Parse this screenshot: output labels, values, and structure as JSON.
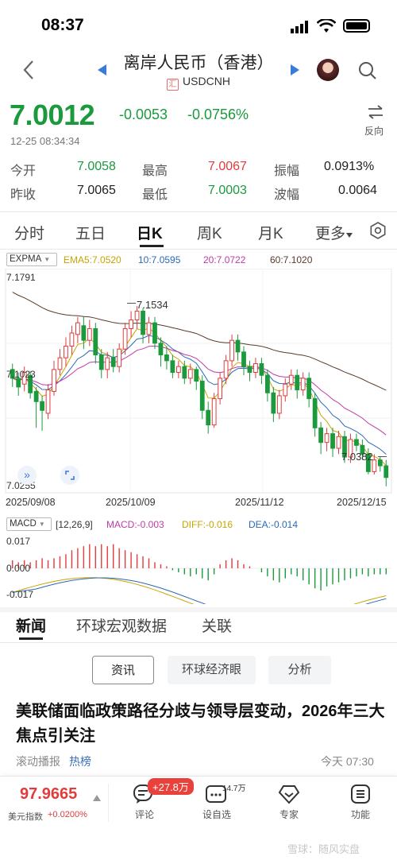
{
  "status_bar": {
    "time": "08:37"
  },
  "header": {
    "title": "离岸人民币（香港）",
    "symbol_icon": "汇",
    "symbol": "USDCNH"
  },
  "quote": {
    "price": "7.0012",
    "change": "-0.0053",
    "change_pct": "-0.0756%",
    "timestamp": "12-25 08:34:34",
    "flip_label": "反向",
    "stats": [
      {
        "label": "今开",
        "value": "7.0058",
        "color": "#1a9a3c"
      },
      {
        "label": "最高",
        "value": "7.0067",
        "color": "#e23b3b"
      },
      {
        "label": "振幅",
        "value": "0.0913%",
        "color": "#222222"
      },
      {
        "label": "昨收",
        "value": "7.0065",
        "color": "#222222"
      },
      {
        "label": "最低",
        "value": "7.0003",
        "color": "#1a9a3c"
      },
      {
        "label": "波幅",
        "value": "0.0064",
        "color": "#222222"
      }
    ]
  },
  "chart_tabs": [
    "分时",
    "五日",
    "日K",
    "周K",
    "月K",
    "更多"
  ],
  "active_chart_tab": "日K",
  "ema_legend": {
    "selector": "EXPMA",
    "ema5": "EMA5:7.0520",
    "ema10": "10:7.0595",
    "ema20": "20:7.0722",
    "ema60": "60:7.1020"
  },
  "price_axis": {
    "top": "7.1791",
    "mid": "7.1023",
    "bottom": "7.0255",
    "hi_mark": "7.1534",
    "lo_mark": "7.0382"
  },
  "dates": [
    "2025/09/08",
    "2025/10/09",
    "2025/11/12",
    "2025/12/15"
  ],
  "macd_legend": {
    "selector": "MACD",
    "params": "[12,26,9]",
    "macd": "MACD:-0.003",
    "diff": "DIFF:-0.016",
    "dea": "DEA:-0.014"
  },
  "macd_axis": {
    "top": "0.017",
    "mid": "0.000",
    "bottom": "-0.017"
  },
  "news_tabs": [
    "新闻",
    "环球宏观数据",
    "关联"
  ],
  "active_news_tab": "新闻",
  "filters": [
    "资讯",
    "环球经济眼",
    "分析"
  ],
  "article": {
    "headline": "美联储面临政策路径分歧与领导层变动，2026年三大焦点引关注",
    "source": "滚动播报",
    "tag": "热榜",
    "time": "今天 07:30"
  },
  "bottom_bar": {
    "index_value": "97.9665",
    "index_name": "美元指数",
    "index_change": "+0.0200%",
    "comment_label": "评论",
    "comment_badge": "+27.8万",
    "watch_label": "设自选",
    "watch_badge": "14.7万",
    "expert_label": "专家",
    "func_label": "功能"
  },
  "watermark": "雪球：随风实盘",
  "chart_data": {
    "type": "candlestick",
    "x_labels": [
      "2025/09/08",
      "2025/10/09",
      "2025/11/12",
      "2025/12/15"
    ],
    "ylim": [
      7.0255,
      7.1791
    ],
    "candles": [
      [
        7.11,
        7.104,
        7.114,
        7.098
      ],
      [
        7.104,
        7.098,
        7.108,
        7.092
      ],
      [
        7.1,
        7.108,
        7.112,
        7.095
      ],
      [
        7.106,
        7.094,
        7.109,
        7.09
      ],
      [
        7.095,
        7.088,
        7.098,
        7.07
      ],
      [
        7.088,
        7.082,
        7.092,
        7.068
      ],
      [
        7.08,
        7.096,
        7.1,
        7.076
      ],
      [
        7.095,
        7.11,
        7.116,
        7.092
      ],
      [
        7.11,
        7.118,
        7.124,
        7.106
      ],
      [
        7.118,
        7.126,
        7.132,
        7.112
      ],
      [
        7.126,
        7.135,
        7.14,
        7.12
      ],
      [
        7.134,
        7.142,
        7.146,
        7.128
      ],
      [
        7.14,
        7.13,
        7.146,
        7.124
      ],
      [
        7.13,
        7.138,
        7.144,
        7.126
      ],
      [
        7.138,
        7.12,
        7.142,
        7.114
      ],
      [
        7.12,
        7.11,
        7.124,
        7.104
      ],
      [
        7.11,
        7.118,
        7.122,
        7.104
      ],
      [
        7.118,
        7.112,
        7.124,
        7.108
      ],
      [
        7.112,
        7.124,
        7.128,
        7.108
      ],
      [
        7.124,
        7.138,
        7.142,
        7.12
      ],
      [
        7.138,
        7.144,
        7.15,
        7.132
      ],
      [
        7.144,
        7.15,
        7.1534,
        7.138
      ],
      [
        7.15,
        7.134,
        7.152,
        7.128
      ],
      [
        7.134,
        7.142,
        7.146,
        7.128
      ],
      [
        7.142,
        7.128,
        7.146,
        7.124
      ],
      [
        7.128,
        7.12,
        7.132,
        7.112
      ],
      [
        7.12,
        7.116,
        7.126,
        7.11
      ],
      [
        7.116,
        7.108,
        7.12,
        7.104
      ],
      [
        7.108,
        7.112,
        7.116,
        7.104
      ],
      [
        7.112,
        7.104,
        7.116,
        7.1
      ],
      [
        7.104,
        7.11,
        7.114,
        7.1
      ],
      [
        7.11,
        7.102,
        7.112,
        7.096
      ],
      [
        7.102,
        7.082,
        7.106,
        7.076
      ],
      [
        7.082,
        7.072,
        7.088,
        7.066
      ],
      [
        7.072,
        7.09,
        7.094,
        7.07
      ],
      [
        7.09,
        7.104,
        7.108,
        7.086
      ],
      [
        7.104,
        7.116,
        7.12,
        7.1
      ],
      [
        7.116,
        7.13,
        7.134,
        7.112
      ],
      [
        7.13,
        7.122,
        7.134,
        7.116
      ],
      [
        7.122,
        7.112,
        7.126,
        7.106
      ],
      [
        7.112,
        7.108,
        7.116,
        7.102
      ],
      [
        7.108,
        7.114,
        7.118,
        7.104
      ],
      [
        7.114,
        7.106,
        7.118,
        7.1
      ],
      [
        7.106,
        7.094,
        7.11,
        7.088
      ],
      [
        7.094,
        7.08,
        7.098,
        7.074
      ],
      [
        7.08,
        7.092,
        7.096,
        7.076
      ],
      [
        7.092,
        7.1,
        7.104,
        7.088
      ],
      [
        7.1,
        7.106,
        7.11,
        7.096
      ],
      [
        7.106,
        7.096,
        7.11,
        7.09
      ],
      [
        7.096,
        7.104,
        7.108,
        7.092
      ],
      [
        7.104,
        7.09,
        7.108,
        7.084
      ],
      [
        7.09,
        7.07,
        7.094,
        7.064
      ],
      [
        7.07,
        7.06,
        7.074,
        7.052
      ],
      [
        7.06,
        7.066,
        7.07,
        7.054
      ],
      [
        7.066,
        7.056,
        7.07,
        7.05
      ],
      [
        7.056,
        7.064,
        7.068,
        7.052
      ],
      [
        7.064,
        7.05,
        7.068,
        7.046
      ],
      [
        7.05,
        7.062,
        7.066,
        7.046
      ],
      [
        7.062,
        7.058,
        7.066,
        7.054
      ],
      [
        7.058,
        7.052,
        7.062,
        7.048
      ],
      [
        7.052,
        7.04,
        7.056,
        7.0382
      ],
      [
        7.04,
        7.048,
        7.052,
        7.038
      ],
      [
        7.048,
        7.044,
        7.05,
        7.04
      ],
      [
        7.044,
        7.036,
        7.048,
        7.03
      ]
    ],
    "macd_bars": [
      0.004,
      0.003,
      0.004,
      0.003,
      0.004,
      0.005,
      0.004,
      0.005,
      0.006,
      0.007,
      0.009,
      0.01,
      0.011,
      0.012,
      0.011,
      0.012,
      0.011,
      0.012,
      0.01,
      0.009,
      0.008,
      0.007,
      0.006,
      0.005,
      0.003,
      0.002,
      0.001,
      -0.001,
      -0.002,
      -0.003,
      -0.004,
      -0.003,
      -0.005,
      -0.006,
      -0.003,
      0.002,
      0.004,
      0.005,
      0.004,
      0.002,
      0.001,
      0.0,
      -0.002,
      -0.004,
      -0.006,
      -0.007,
      -0.005,
      -0.003,
      -0.004,
      -0.006,
      -0.008,
      -0.01,
      -0.011,
      -0.009,
      -0.008,
      -0.007,
      -0.006,
      -0.005,
      -0.004,
      -0.003,
      -0.004,
      -0.003,
      -0.003,
      -0.003
    ]
  }
}
